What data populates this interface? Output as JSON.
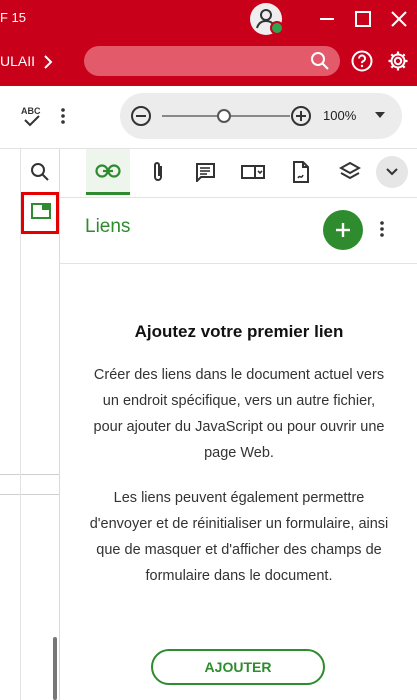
{
  "titlebar": {
    "doc_title": "F 15"
  },
  "menubar": {
    "label": "ULAII",
    "search": {
      "placeholder": ""
    }
  },
  "zoom": {
    "value_label": "100%",
    "level_percent": 100
  },
  "tabs": [
    "link-icon",
    "paperclip-icon",
    "comment-icon",
    "form-field-icon",
    "sign-icon",
    "layers-icon"
  ],
  "panel": {
    "title": "Liens",
    "empty_title": "Ajoutez votre premier lien",
    "para1": "Créer des liens dans le document actuel vers un endroit spécifique, vers un autre fichier, pour ajouter du JavaScript ou pour ouvrir une page Web.",
    "para2": "Les liens peuvent également permettre d'envoyer et de réinitialiser un formulaire, ainsi que de masquer et d'afficher des champs de formulaire dans le document.",
    "add_label": "AJOUTER"
  },
  "colors": {
    "brand": "#c8001a",
    "accent": "#2e8b2e",
    "highlight": "#e40000"
  }
}
